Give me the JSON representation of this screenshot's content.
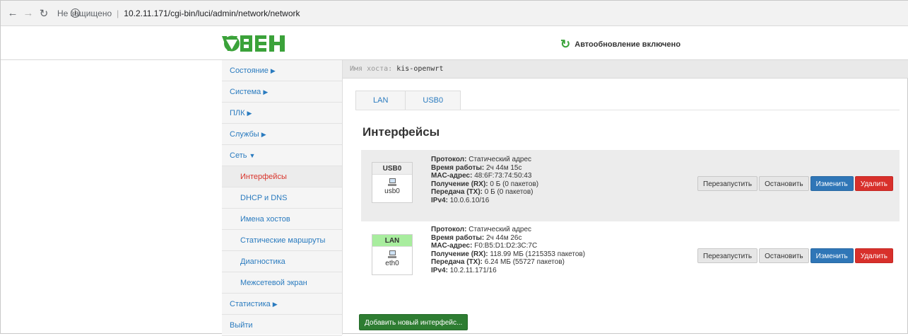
{
  "browser": {
    "back_icon": "arrow-left-icon",
    "forward_icon": "arrow-right-icon",
    "reload_icon": "reload-icon",
    "security_label": "Не защищено",
    "url": "10.2.11.171/cgi-bin/luci/admin/network/network"
  },
  "header": {
    "logo_text": "ОВЕН",
    "logo_color": "#3ba23a",
    "autorefresh_label": "Автообновление включено"
  },
  "sidebar": {
    "items": [
      {
        "label": "Состояние",
        "caret": "▶"
      },
      {
        "label": "Система",
        "caret": "▶"
      },
      {
        "label": "ПЛК",
        "caret": "▶"
      },
      {
        "label": "Службы",
        "caret": "▶"
      },
      {
        "label": "Сеть",
        "caret": "▼"
      }
    ],
    "sub_items": [
      {
        "label": "Интерфейсы"
      },
      {
        "label": "DHCP и DNS"
      },
      {
        "label": "Имена хостов"
      },
      {
        "label": "Статические маршруты"
      },
      {
        "label": "Диагностика"
      },
      {
        "label": "Межсетевой экран"
      }
    ],
    "bottom_items": [
      {
        "label": "Статистика",
        "caret": "▶"
      },
      {
        "label": "Выйти"
      }
    ]
  },
  "hostbar": {
    "label": "Имя хоста:",
    "value": "kis-openwrt"
  },
  "tabs": [
    {
      "label": "LAN"
    },
    {
      "label": "USB0"
    }
  ],
  "page_title": "Интерфейсы",
  "interfaces": [
    {
      "name": "USB0",
      "device": "usb0",
      "protocol_label": "Протокол:",
      "protocol": "Статический адрес",
      "uptime_label": "Время работы:",
      "uptime": "2ч 44м 15с",
      "mac_label": "MAC-адрес:",
      "mac": "48:6F:73:74:50:43",
      "rx_label": "Получение (RX):",
      "rx": "0 Б (0 пакетов)",
      "tx_label": "Передача (TX):",
      "tx": "0 Б (0 пакетов)",
      "ipv4_label": "IPv4:",
      "ipv4": "10.0.6.10/16"
    },
    {
      "name": "LAN",
      "device": "eth0",
      "protocol_label": "Протокол:",
      "protocol": "Статический адрес",
      "uptime_label": "Время работы:",
      "uptime": "2ч 44м 26с",
      "mac_label": "MAC-адрес:",
      "mac": "F0:B5:D1:D2:3C:7C",
      "rx_label": "Получение (RX):",
      "rx": "118.99 МБ (1215353 пакетов)",
      "tx_label": "Передача (TX):",
      "tx": "6.24 МБ (55727 пакетов)",
      "ipv4_label": "IPv4:",
      "ipv4": "10.2.11.171/16"
    }
  ],
  "buttons": {
    "restart": "Перезапустить",
    "stop": "Остановить",
    "edit": "Изменить",
    "delete": "Удалить"
  },
  "add_button": "Добавить новый интерфейс...",
  "colors": {
    "link": "#2a7bbf",
    "active_menu": "#d9342b",
    "lan_badge": "#a8ed9e",
    "edit_button": "#2f76b7",
    "delete_button": "#d8302b",
    "add_button": "#2e7d32",
    "autorefresh_icon": "#3aa33a"
  }
}
